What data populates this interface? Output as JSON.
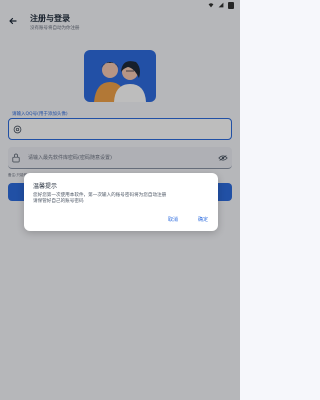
{
  "header": {
    "title": "注册与登录",
    "subtitle": "没有账号将自动为你注册"
  },
  "form": {
    "account_label": "请输入QQ号(用于添加头像)",
    "password_placeholder": "请输入最先软件库密码(密码随意设置)",
    "hint": "备注:只能输入数字或者最多不超过多少位，密码不能为空，密码不可以是QQ密码，为确保账号安全请使用强密码"
  },
  "dialog": {
    "title": "温馨提示",
    "body": "您好您第一次使用本软件，第一次输入的账号密码将为您自动注册\n请保管好自己的账号密码",
    "cancel": "取消",
    "confirm": "确定"
  },
  "colors": {
    "accent": "#2d6cdf",
    "background": "#f6f7fb",
    "illustration_bg": "#2f6de1",
    "overlay": "rgba(0,0,0,0.26)"
  },
  "icons": {
    "back": "back-arrow-icon",
    "account": "at-icon",
    "password": "lock-icon",
    "visibility": "eye-icon"
  }
}
